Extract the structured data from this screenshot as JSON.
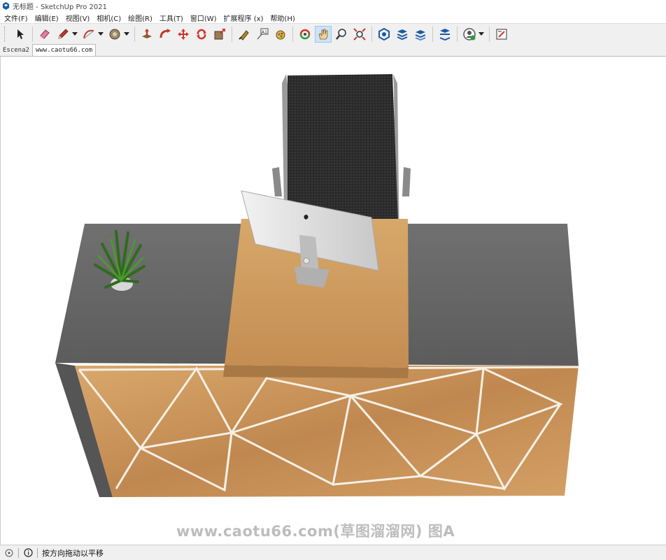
{
  "window": {
    "title": "无标题 - SketchUp Pro 2021"
  },
  "menu": [
    "文件(F)",
    "编辑(E)",
    "视图(V)",
    "相机(C)",
    "绘图(R)",
    "工具(T)",
    "窗口(W)",
    "扩展程序 (x)",
    "帮助(H)"
  ],
  "toolbar": {
    "icons": [
      "select-icon",
      "eraser-icon",
      "pencil-icon",
      "arc-icon",
      "tape-measure-icon",
      "push-pull-icon",
      "follow-me-icon",
      "move-icon",
      "rotate-icon",
      "scale-icon",
      "paint-bucket-icon",
      "text-label-icon",
      "paint-icon",
      "orbit-icon",
      "pan-icon",
      "zoom-icon",
      "zoom-extents-icon",
      "3d-warehouse-icon",
      "extension-warehouse-icon",
      "layout-icon",
      "section-icon",
      "account-icon",
      "send-to-layout-icon"
    ],
    "active": "pan-icon"
  },
  "tabs": [
    {
      "label": "Escena2",
      "selected": true
    },
    {
      "label": "www.caotu66.com",
      "selected": false
    }
  ],
  "watermark": "www.caotu66.com(草图溜溜网) 图A",
  "status": {
    "message": "按方向拖动以平移"
  },
  "colors": {
    "toolbar_bg": "#f0f0f0",
    "active_tool": "#cce4f7",
    "desk_top": "#6b6b6b",
    "wood": "#c8955a"
  }
}
